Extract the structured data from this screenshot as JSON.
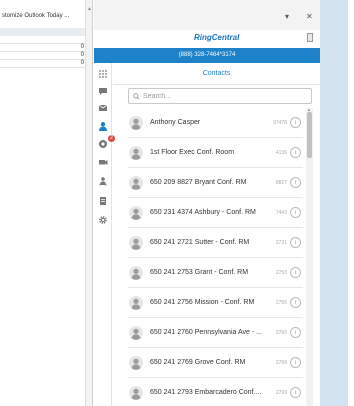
{
  "left_pane": {
    "title": "stomize Outlook Today ...",
    "rows": [
      {
        "value": ""
      },
      {
        "value": "0"
      },
      {
        "value": "0"
      },
      {
        "value": "0"
      }
    ]
  },
  "window": {
    "dropdown_glyph": "▾",
    "close_glyph": "✕"
  },
  "brand": {
    "logo_main": "RingCentral",
    "logo_accent": "",
    "phone": "(888) 328-7464*3174"
  },
  "contacts": {
    "title": "Contacts",
    "search_placeholder": "Search...",
    "items": [
      {
        "name": "Anthony Casper",
        "ext": "97478"
      },
      {
        "name": "1st Floor Exec Conf. Room",
        "ext": "4136"
      },
      {
        "name": "650 209 8827 Bryant Conf. RM",
        "ext": "8827"
      },
      {
        "name": "650 231 4374 Ashbury - Conf. RM",
        "ext": "7443"
      },
      {
        "name": "650 241 2721 Sutter - Conf. RM",
        "ext": "2721"
      },
      {
        "name": "650 241 2753 Grant - Conf. RM",
        "ext": "2753"
      },
      {
        "name": "650 241 2756 Mission - Conf. RM",
        "ext": "2756"
      },
      {
        "name": "650 241 2760 Pennsylvania Ave - ...",
        "ext": "2760"
      },
      {
        "name": "650 241 2769 Grove Conf. RM",
        "ext": "2769"
      },
      {
        "name": "650 241 2793 Embarcadero Conf....",
        "ext": "2793"
      }
    ]
  },
  "rail": {
    "badge_count": "2"
  },
  "colors": {
    "brand_blue": "#1e82c8",
    "brand_orange": "#f7941d",
    "badge_red": "#e04646",
    "side_blue": "#d3e3f0"
  }
}
